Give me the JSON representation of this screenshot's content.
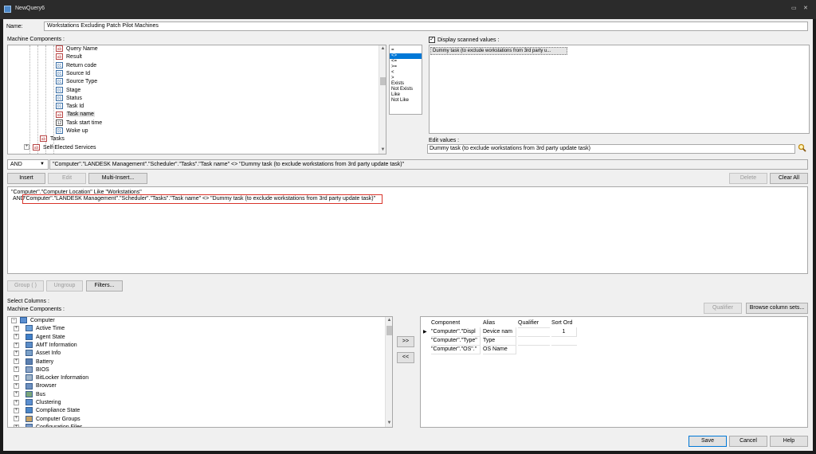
{
  "window": {
    "title": "NewQuery6",
    "title_icon": "query-icon",
    "controls": {
      "restore": "▭",
      "close": "✕"
    }
  },
  "name_field": {
    "label": "Name:",
    "value": "Workstations Excluding Patch Pilot Machines"
  },
  "machine_components_label": "Machine Components :",
  "tree_top": {
    "items": [
      {
        "label": "Query Name",
        "icon": "ab"
      },
      {
        "label": "Result",
        "icon": "ab"
      },
      {
        "label": "Return code",
        "icon": "01"
      },
      {
        "label": "Source Id",
        "icon": "01"
      },
      {
        "label": "Source Type",
        "icon": "01"
      },
      {
        "label": "Stage",
        "icon": "01"
      },
      {
        "label": "Status",
        "icon": "01"
      },
      {
        "label": "Task Id",
        "icon": "01"
      },
      {
        "label": "Task name",
        "icon": "ab"
      },
      {
        "label": "Task start time",
        "icon": "12"
      },
      {
        "label": "Woke up",
        "icon": "01"
      },
      {
        "label": "Tasks",
        "icon": "ab"
      },
      {
        "label": "Self-Elected Services",
        "icon": "ab"
      }
    ],
    "selected": "Task name"
  },
  "operators": {
    "items": [
      "=",
      "<>",
      "<=",
      ">=",
      "<",
      ">",
      "Exists",
      "Not Exists",
      "Like",
      "Not Like"
    ],
    "selected": "<>"
  },
  "scanned_values": {
    "checkbox_label": "Display scanned values :",
    "checked": true,
    "items": [
      "Dummy task (to exclude workstations from 3rd party u..."
    ]
  },
  "edit_values": {
    "label": "Edit values :",
    "value": "Dummy task (to exclude workstations from 3rd party update task)"
  },
  "logic_select": {
    "value": "AND"
  },
  "expression_preview": "\"Computer\".\"LANDESK Management\".\"Scheduler\".\"Tasks\".\"Task name\"  <>  \"Dummy task (to exclude workstations from 3rd party update task)\"",
  "buttons_row1": {
    "insert": "Insert",
    "edit": "Edit",
    "multi_insert": "Multi-Insert...",
    "delete": "Delete",
    "clear_all": "Clear All"
  },
  "query_lines": {
    "line1": "\"Computer\".\"Computer Location\"  Like  \"Workstations\"",
    "line2_prefix": "AND",
    "line2_highlight": "\"Computer\".\"LANDESK Management\".\"Scheduler\".\"Tasks\".\"Task name\"  <>  \"Dummy task (to exclude workstations from 3rd party update task)\""
  },
  "buttons_row2": {
    "group": "Group ( )",
    "ungroup": "Ungroup",
    "filters": "Filters..."
  },
  "select_columns_label": "Select Columns :",
  "machine_components_label2": "Machine Components :",
  "tree_bottom": {
    "root": "Computer",
    "items": [
      {
        "label": "Active Time",
        "icon": "clock-icon"
      },
      {
        "label": "Agent State",
        "icon": "agent-icon"
      },
      {
        "label": "AMT Information",
        "icon": "amt-icon"
      },
      {
        "label": "Asset Info",
        "icon": "asset-icon"
      },
      {
        "label": "Battery",
        "icon": "battery-icon"
      },
      {
        "label": "BIOS",
        "icon": "bios-icon"
      },
      {
        "label": "BitLocker Information",
        "icon": "bitlocker-icon"
      },
      {
        "label": "Browser",
        "icon": "browser-icon"
      },
      {
        "label": "Bus",
        "icon": "bus-icon"
      },
      {
        "label": "Clustering",
        "icon": "cluster-icon"
      },
      {
        "label": "Compliance State",
        "icon": "compliance-icon"
      },
      {
        "label": "Computer Groups",
        "icon": "groups-icon"
      },
      {
        "label": "Configuration Files",
        "icon": "config-icon"
      }
    ]
  },
  "move_buttons": {
    "add": ">>",
    "remove": "<<"
  },
  "qualifier_button": "Qualifier",
  "browse_button": "Browse column sets...",
  "columns_table": {
    "headers": [
      "Component",
      "Alias",
      "Qualifier",
      "Sort Ord"
    ],
    "rows": [
      {
        "component": "\"Computer\".\"Displ",
        "alias": "Device nam",
        "qualifier": "",
        "sort": "1",
        "current": true
      },
      {
        "component": "\"Computer\".\"Type\"",
        "alias": "Type",
        "qualifier": "",
        "sort": ""
      },
      {
        "component": "\"Computer\".\"OS\".\"",
        "alias": "OS Name",
        "qualifier": "",
        "sort": ""
      }
    ]
  },
  "footer": {
    "save": "Save",
    "cancel": "Cancel",
    "help": "Help"
  },
  "colors": {
    "highlight_box": "#d9342b",
    "selection": "#0078d7",
    "titlebar": "#2b2b2b"
  }
}
